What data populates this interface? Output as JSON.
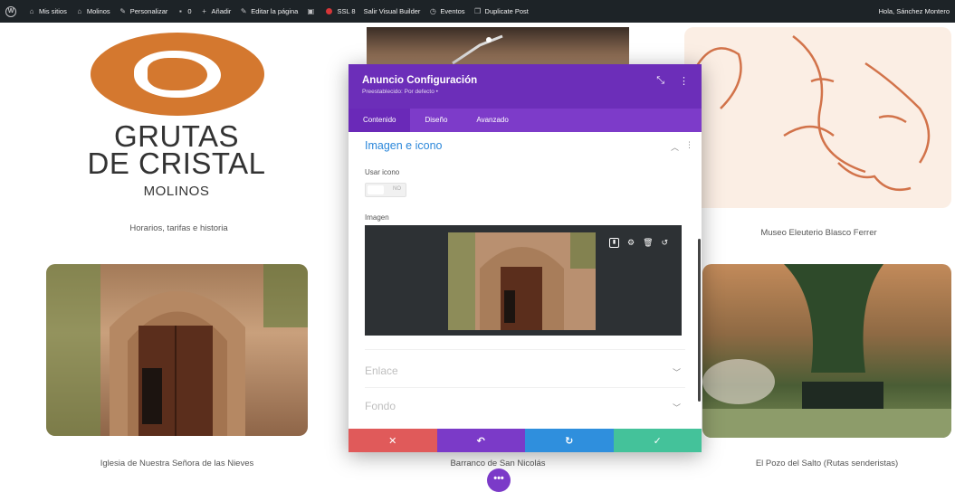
{
  "adminbar": {
    "items": [
      "Mis sitios",
      "Molinos",
      "Personalizar",
      "0",
      "Añadir",
      "Editar la página",
      "SSL 8",
      "Salir Visual Builder",
      "Eventos",
      "Duplicate Post"
    ],
    "greeting": "Hola, Sánchez Montero"
  },
  "logo": {
    "line1": "GRUTAS",
    "line2": "DE CRISTAL",
    "line3": "MOLINOS",
    "color": "#d4782f"
  },
  "page": {
    "captions": {
      "top_left": "Horarios, tarifas e historia",
      "top_right": "Museo Eleuterio Blasco Ferrer",
      "bottom_left": "Iglesia de Nuestra Señora de las Nieves",
      "bottom_middle": "Barranco de San Nicolás",
      "bottom_right": "El Pozo del Salto (Rutas senderistas)"
    }
  },
  "modal": {
    "title": "Anuncio Configuración",
    "subtitle": "Preestablecido: Por defecto •",
    "tabs": [
      "Contenido",
      "Diseño",
      "Avanzado"
    ],
    "section_open": "Imagen e icono",
    "use_icon_label": "Usar icono",
    "toggle_value": "NO",
    "image_label": "Imagen",
    "section_link": "Enlace",
    "section_background": "Fondo",
    "header_color": "#6c2eb9",
    "footer_colors": [
      "#e05a5a",
      "#7b3ac8",
      "#2f8fdd",
      "#44c29a"
    ]
  },
  "fab": {
    "label": "•••"
  }
}
